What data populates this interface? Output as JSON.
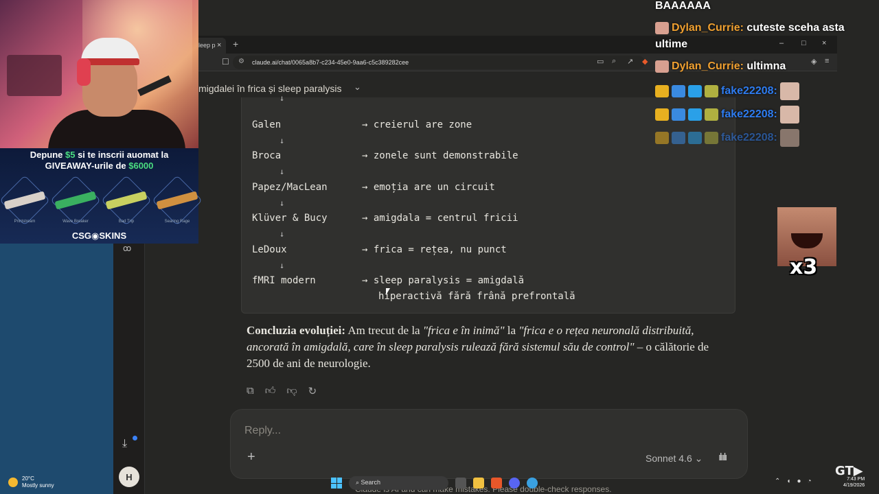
{
  "browser": {
    "tab_label": "leep p",
    "tab_close": "×",
    "new_tab": "+",
    "url": "claude.ai/chat/0065a8b7-c234-45e0-9aa6-c5c389282cee",
    "window_controls": [
      "–",
      "□",
      "×"
    ]
  },
  "claude": {
    "chat_title": "migdalei în frica și sleep paralysis",
    "code_lines": [
      {
        "left": "Galen",
        "right": "→ creierul are zone"
      },
      {
        "left": "Broca",
        "right": "→ zonele sunt demonstrabile"
      },
      {
        "left": "Papez/MacLean",
        "right": "→ emoția are un circuit"
      },
      {
        "left": "Klüver & Bucy",
        "right": "→ amigdala = centrul fricii"
      },
      {
        "left": "LeDoux",
        "right": "→ frica = rețea, nu punct"
      },
      {
        "left": "fMRI modern",
        "right": "→ sleep paralysis = amigdală"
      }
    ],
    "code_continuation": "hiperactivă fără frână prefrontală",
    "conclusion_label": "Concluzia evoluției:",
    "conclusion_text_1": " Am trecut de la ",
    "conclusion_quote_1": "\"frica e în inimă\"",
    "conclusion_text_2": " la ",
    "conclusion_quote_2": "\"frica e o rețea neuronală distribuită, ancorată în amigdală, care în sleep paralysis rulează fără sistemul său de control\"",
    "conclusion_text_3": " – o călătorie de 2500 de ani de neurologie.",
    "reply_placeholder": "Reply...",
    "model": "Sonnet 4.6",
    "disclaimer": "Claude is AI and can make mistakes. Please double-check responses.",
    "avatar_initial": "H"
  },
  "desktop": {
    "weather_temp": "20°C",
    "weather_desc": "Mostly sunny",
    "search_label": "Search",
    "clock_time": "7:43 PM",
    "clock_date": "4/19/2026"
  },
  "stream": {
    "giveaway_line1_a": "Depune ",
    "giveaway_line1_amount": "$5",
    "giveaway_line1_b": " si te inscrii auomat la",
    "giveaway_line2_a": "GIVEAWAY-urile de ",
    "giveaway_line2_amount": "$6000",
    "skins": [
      "Printstream",
      "Wave Breaker",
      "Bad Trip",
      "Searing Rage"
    ],
    "brand": "CSG◉SKINS",
    "chat": {
      "line0": "BAAAAAA",
      "user1": "Dylan_Currie:",
      "msg1": " cuteste sceha asta",
      "msg1b": "ultime",
      "user2": "Dylan_Currie:",
      "msg2": " ultimna",
      "user3": "fake22208:",
      "user4": "fake22208:",
      "user5": "fake22208:"
    },
    "meme_multiplier": "x3",
    "gt_logo": "GT▶"
  }
}
